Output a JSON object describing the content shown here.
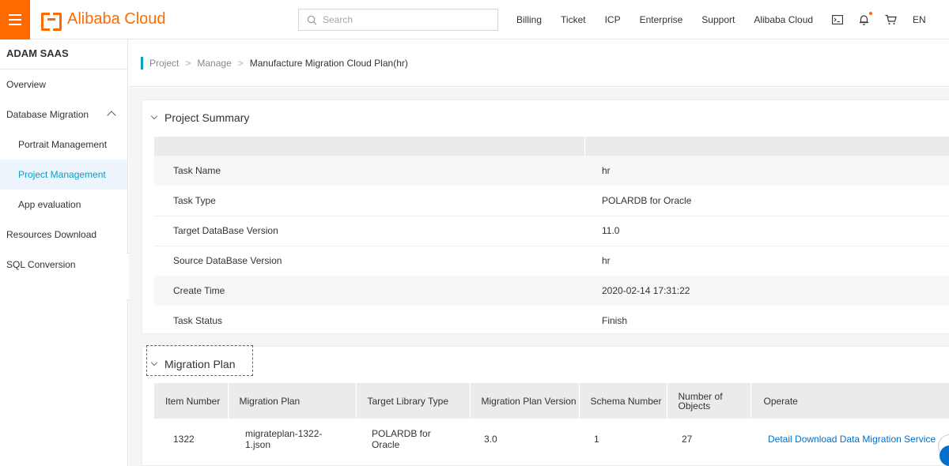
{
  "header": {
    "logo_text": "Alibaba Cloud",
    "search_placeholder": "Search",
    "nav": [
      "Billing",
      "Ticket",
      "ICP",
      "Enterprise",
      "Support",
      "Alibaba Cloud"
    ],
    "lang": "EN",
    "accent": "#ff6a00"
  },
  "sidebar": {
    "title": "ADAM SAAS",
    "items": [
      {
        "label": "Overview"
      },
      {
        "label": "Database Migration"
      },
      {
        "label": "Portrait Management"
      },
      {
        "label": "Project Management"
      },
      {
        "label": "App evaluation"
      },
      {
        "label": "Resources Download"
      },
      {
        "label": "SQL Conversion"
      }
    ],
    "active_color": "#00a2ca",
    "collapse_glyph": "«"
  },
  "breadcrumb": {
    "items": [
      "Project",
      "Manage",
      "Manufacture Migration Cloud Plan(hr)"
    ],
    "sep": ">"
  },
  "summary": {
    "title": "Project Summary",
    "rows": [
      {
        "key": "Task Name",
        "value": "hr"
      },
      {
        "key": "Task Type",
        "value": "POLARDB for Oracle"
      },
      {
        "key": "Target DataBase Version",
        "value": "11.0"
      },
      {
        "key": "Source DataBase Version",
        "value": "hr"
      },
      {
        "key": "Create Time",
        "value": "2020-02-14 17:31:22"
      },
      {
        "key": "Task Status",
        "value": "Finish"
      }
    ]
  },
  "plan": {
    "title": "Migration Plan",
    "columns": [
      "Item Number",
      "Migration Plan",
      "Target Library Type",
      "Migration Plan Version",
      "Schema Number",
      "Number of Objects",
      "Operate"
    ],
    "row": {
      "item_number": "1322",
      "migration_plan": "migrateplan-1322-1.json",
      "target_library_type": "POLARDB for Oracle",
      "version": "3.0",
      "schema_number": "1",
      "objects": "27",
      "ops": [
        "Detail",
        "Download",
        "Data Migration Service"
      ]
    },
    "link_color": "#0070cc",
    "highlight_color": "#e0302b"
  }
}
